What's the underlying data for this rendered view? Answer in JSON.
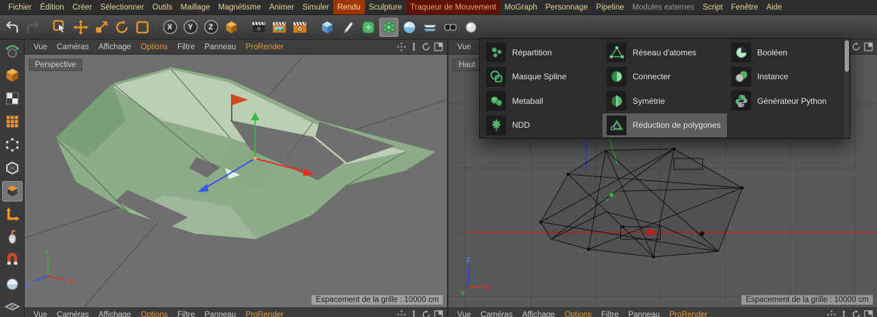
{
  "menubar": {
    "items": [
      {
        "label": "Fichier"
      },
      {
        "label": "Édition"
      },
      {
        "label": "Créer"
      },
      {
        "label": "Sélectionner"
      },
      {
        "label": "Outils"
      },
      {
        "label": "Maillage"
      },
      {
        "label": "Magnétisme"
      },
      {
        "label": "Animer"
      },
      {
        "label": "Simuler"
      },
      {
        "label": "Rendu",
        "highlight": "bright"
      },
      {
        "label": "Sculpture"
      },
      {
        "label": "Traqueur de Mouvement",
        "highlight": "dark"
      },
      {
        "label": "MoGraph"
      },
      {
        "label": "Personnage"
      },
      {
        "label": "Pipeline"
      },
      {
        "label": "Modules externes",
        "muted": true
      },
      {
        "label": "Script"
      },
      {
        "label": "Fenêtre"
      },
      {
        "label": "Aide"
      }
    ]
  },
  "toolbar": {
    "buttons": [
      {
        "name": "undo-button",
        "type": "undo"
      },
      {
        "name": "redo-button",
        "type": "redo",
        "disabled": true
      },
      {
        "type": "sep"
      },
      {
        "name": "live-selection-tool",
        "type": "select"
      },
      {
        "name": "move-tool",
        "type": "move"
      },
      {
        "name": "scale-tool",
        "type": "scale"
      },
      {
        "name": "rotate-tool",
        "type": "rotate"
      },
      {
        "name": "last-used-tool",
        "type": "lasttool"
      },
      {
        "type": "sep"
      },
      {
        "name": "lock-x-axis-button",
        "type": "axis",
        "letter": "X"
      },
      {
        "name": "lock-y-axis-button",
        "type": "axis",
        "letter": "Y"
      },
      {
        "name": "lock-z-axis-button",
        "type": "axis",
        "letter": "Z"
      },
      {
        "name": "coordinate-system-button",
        "type": "coord"
      },
      {
        "type": "sep"
      },
      {
        "name": "render-view-button",
        "type": "clapdark"
      },
      {
        "name": "render-region-button",
        "type": "claporange"
      },
      {
        "name": "render-settings-button",
        "type": "clapgear"
      },
      {
        "type": "sep"
      },
      {
        "name": "add-primitive-button",
        "type": "cubeblue"
      },
      {
        "name": "add-spline-button",
        "type": "pen"
      },
      {
        "name": "subdivision-surface-button",
        "type": "gengreen"
      },
      {
        "name": "generators-palette-button",
        "type": "genflower",
        "active": true
      },
      {
        "name": "sky-object-button",
        "type": "sky"
      },
      {
        "name": "floor-object-button",
        "type": "floor"
      },
      {
        "name": "camera-object-button",
        "type": "camera"
      },
      {
        "name": "light-object-button",
        "type": "light"
      }
    ]
  },
  "side_palette": {
    "buttons": [
      {
        "name": "make-editable-button",
        "type": "editable"
      },
      {
        "name": "model-mode-button",
        "type": "coord"
      },
      {
        "name": "texture-mode-button",
        "type": "uvchecker"
      },
      {
        "name": "texture-axis-mode-button",
        "type": "waffle"
      },
      {
        "name": "points-mode-button",
        "type": "points"
      },
      {
        "name": "edges-mode-button",
        "type": "edges"
      },
      {
        "name": "polygons-mode-button",
        "type": "polys",
        "active": true
      },
      {
        "name": "enable-axis-button",
        "type": "axismode"
      },
      {
        "name": "tweak-mode-button",
        "type": "mouse"
      },
      {
        "name": "snap-toggle-button",
        "type": "snap"
      },
      {
        "name": "quantize-toggle-button",
        "type": "quantize"
      },
      {
        "name": "workplane-mode-button",
        "type": "workplane"
      }
    ]
  },
  "viewport_menu": {
    "items": [
      {
        "label": "Vue"
      },
      {
        "label": "Caméras"
      },
      {
        "label": "Affichage"
      },
      {
        "label": "Options",
        "accent": true
      },
      {
        "label": "Filtre"
      },
      {
        "label": "Panneau"
      },
      {
        "label": "ProRender",
        "accent": true
      }
    ]
  },
  "nav_icons": [
    {
      "name": "pan-view-icon",
      "glyph": "pan"
    },
    {
      "name": "dolly-view-icon",
      "glyph": "dolly"
    },
    {
      "name": "rotate-view-icon",
      "glyph": "rotateview"
    },
    {
      "name": "toggle-layout-icon",
      "glyph": "toggleview"
    }
  ],
  "viewports": {
    "left": {
      "view_label": "Perspective",
      "grid_status": "Espacement de la grille : 10000 cm"
    },
    "right": {
      "view_label": "Haut",
      "grid_status": "Espacement de la grille : 10000 cm"
    }
  },
  "axis_triad": {
    "x": "X",
    "y": "Y",
    "z": "Z"
  },
  "popup": {
    "items": [
      {
        "label": "Répartition",
        "icon_name": "repartition-icon",
        "glyph": "repartition"
      },
      {
        "label": "Masque Spline",
        "icon_name": "mask-spline-icon",
        "glyph": "maskspline"
      },
      {
        "label": "Metaball",
        "icon_name": "metaball-icon",
        "glyph": "metaball"
      },
      {
        "label": "NDD",
        "icon_name": "ndd-leaf-icon",
        "glyph": "ndd"
      },
      {
        "label": "Réseau d'atomes",
        "icon_name": "atom-array-icon",
        "glyph": "atomarray"
      },
      {
        "label": "Connecter",
        "icon_name": "connect-icon",
        "glyph": "connect"
      },
      {
        "label": "Symétrie",
        "icon_name": "symmetry-icon",
        "glyph": "symmetry"
      },
      {
        "label": "Réduction de polygones",
        "icon_name": "polygon-reduction-icon",
        "glyph": "polyreduction",
        "highlighted": true
      },
      {
        "label": "Booléen",
        "icon_name": "boolean-icon",
        "glyph": "boolean"
      },
      {
        "label": "Instance",
        "icon_name": "instance-icon",
        "glyph": "instance"
      },
      {
        "label": "Générateur Python",
        "icon_name": "python-generator-icon",
        "glyph": "python"
      }
    ]
  },
  "colors": {
    "accent_orange": "#e89a30",
    "menu_highlight_red": "#a03608",
    "generator_green": "#53b469"
  }
}
